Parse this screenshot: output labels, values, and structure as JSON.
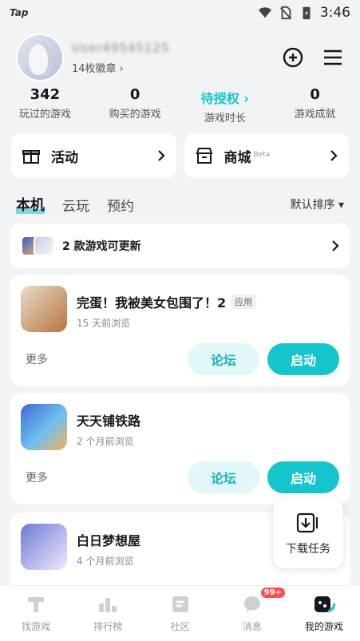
{
  "status_bar": {
    "app_tag": "Tap",
    "time": "3:46"
  },
  "profile": {
    "username": "User49545125",
    "badges": "14枚徽章 ›"
  },
  "stats": [
    {
      "num": "342",
      "label": "玩过的游戏"
    },
    {
      "num": "0",
      "label": "购买的游戏"
    },
    {
      "num": "待授权 ›",
      "label": "游戏时长"
    },
    {
      "num": "0",
      "label": "游戏成就"
    }
  ],
  "quick": {
    "activity": "活动",
    "store": "商城",
    "store_beta": "Beta"
  },
  "tabs": [
    "本机",
    "云玩",
    "预约"
  ],
  "sort_label": "默认排序 ▾",
  "update_bar": {
    "text": "2 款游戏可更新"
  },
  "games": [
    {
      "title": "完蛋！我被美女包围了！2",
      "badge": "应用",
      "sub": "15 天前浏览",
      "more": "更多",
      "forum": "论坛",
      "launch": "启动"
    },
    {
      "title": "天天铺铁路",
      "badge": "",
      "sub": "2 个月前浏览",
      "more": "更多",
      "forum": "论坛",
      "launch": "启动"
    },
    {
      "title": "白日梦想屋",
      "badge": "",
      "sub": "4 个月前浏览",
      "more": "",
      "forum": "",
      "launch": ""
    }
  ],
  "download_task": "下载任务",
  "nav": [
    {
      "label": "找游戏",
      "icon": "find-game-icon"
    },
    {
      "label": "排行榜",
      "icon": "ranking-icon"
    },
    {
      "label": "社区",
      "icon": "community-icon"
    },
    {
      "label": "消息",
      "icon": "message-icon",
      "badge": "99+"
    },
    {
      "label": "我的游戏",
      "icon": "my-games-icon"
    }
  ],
  "colors": {
    "accent": "#15c5ce",
    "badge_red": "#ff4d4f"
  }
}
